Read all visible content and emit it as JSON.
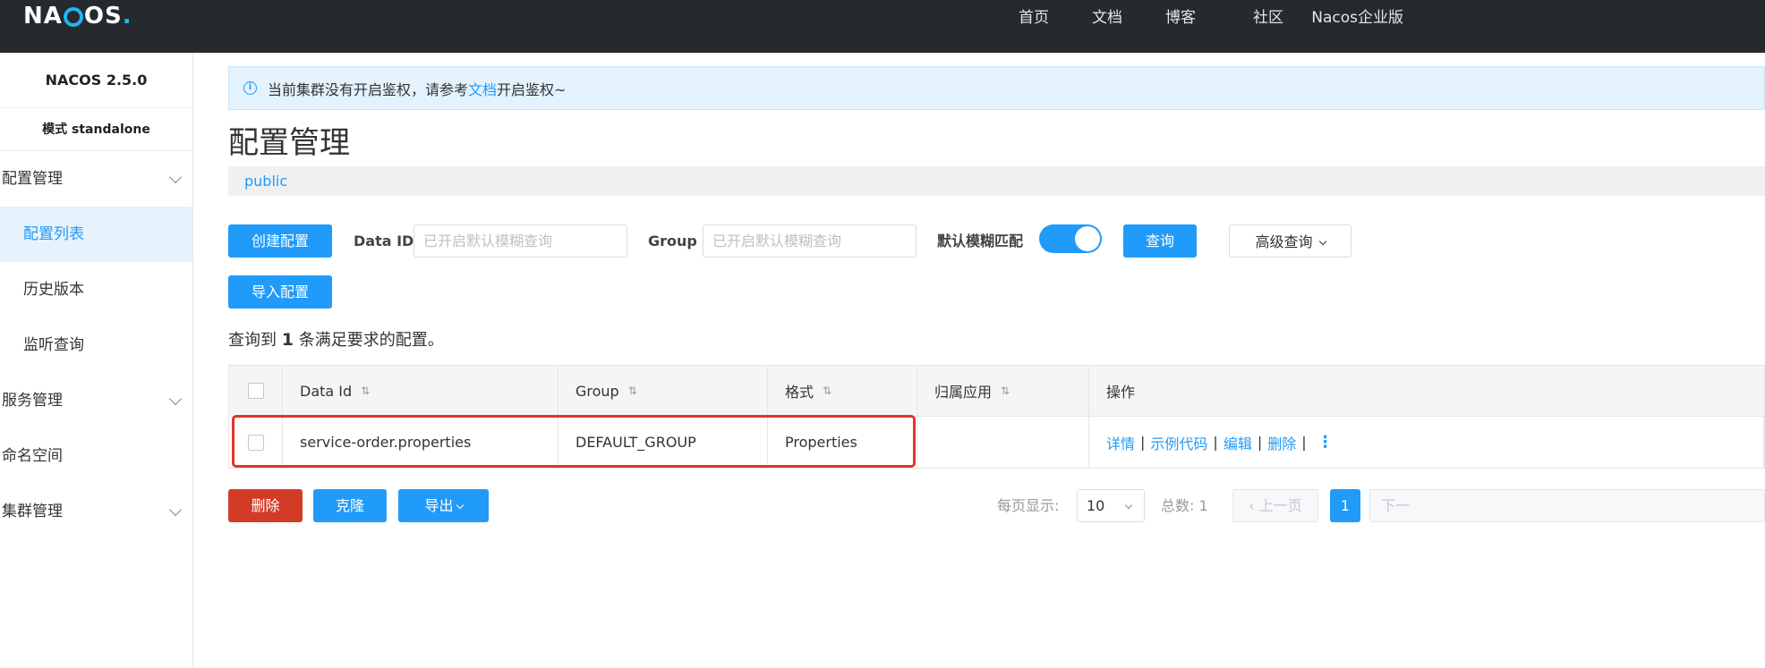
{
  "topbar": {
    "logo": "NACOS.",
    "nav": [
      "首页",
      "文档",
      "博客",
      "社区",
      "Nacos企业版"
    ]
  },
  "sidebar": {
    "version": "NACOS 2.5.0",
    "mode": "模式 standalone",
    "groups": [
      {
        "label": "配置管理",
        "items": [
          "配置列表",
          "历史版本",
          "监听查询"
        ]
      },
      {
        "label": "服务管理"
      },
      {
        "label": "命名空间"
      },
      {
        "label": "集群管理"
      }
    ]
  },
  "notice": {
    "before": "当前集群没有开启鉴权，请参考",
    "link": "文档",
    "after": "开启鉴权~"
  },
  "page_title": "配置管理",
  "namespace": "public",
  "toolbar": {
    "create": "创建配置",
    "import": "导入配置",
    "dataid_label": "Data ID",
    "dataid_placeholder": "已开启默认模糊查询",
    "group_label": "Group",
    "group_placeholder": "已开启默认模糊查询",
    "fuzzy_label": "默认模糊匹配",
    "fuzzy_on": true,
    "query": "查询",
    "advanced": "高级查询"
  },
  "result": {
    "prefix": "查询到",
    "count": "1",
    "suffix": "条满足要求的配置。"
  },
  "table": {
    "headers": [
      "Data Id",
      "Group",
      "格式",
      "归属应用",
      "操作"
    ],
    "rows": [
      {
        "data_id": "service-order.properties",
        "group": "DEFAULT_GROUP",
        "format": "Properties",
        "app": ""
      }
    ],
    "actions": [
      "详情",
      "示例代码",
      "编辑",
      "删除"
    ]
  },
  "footer": {
    "delete": "删除",
    "clone": "克隆",
    "export": "导出",
    "page_size_label": "每页显示:",
    "page_size": "10",
    "total": "总数: 1",
    "prev": "上一页",
    "current_page": "1",
    "next": "下一"
  },
  "colors": {
    "primary": "#209bfa",
    "danger": "#d23c26",
    "topbar": "#252a2f",
    "highlight": "#e1322b"
  }
}
